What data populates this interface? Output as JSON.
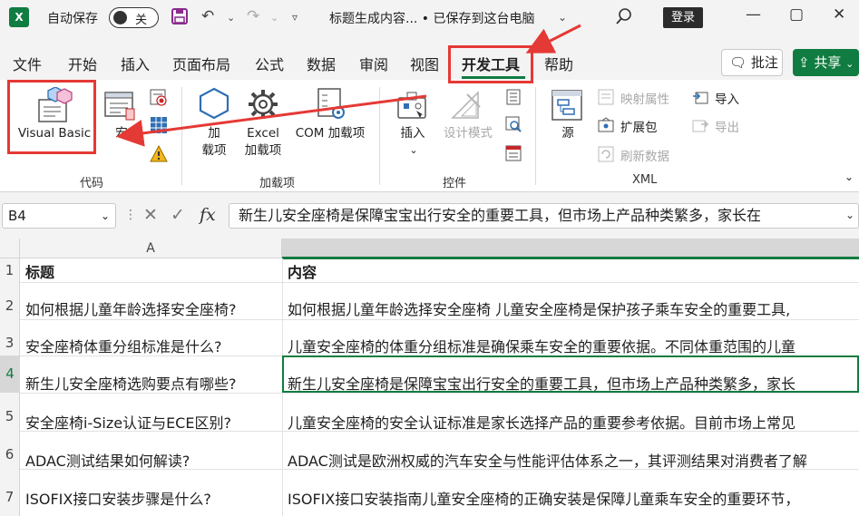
{
  "titlebar": {
    "app_icon": "X",
    "autosave_label": "自动保存",
    "autosave_state": "关",
    "doc_title": "标题生成内容... • 已保存到这台电脑",
    "login": "登录",
    "icons": [
      "save-icon",
      "undo-icon",
      "redo-icon",
      "customize-icon",
      "search-icon",
      "minimize-icon",
      "maximize-icon",
      "close-icon"
    ]
  },
  "tabs": [
    "文件",
    "开始",
    "插入",
    "页面布局",
    "公式",
    "数据",
    "审阅",
    "视图",
    "开发工具",
    "帮助"
  ],
  "active_tab": "开发工具",
  "comment_btn": "批注",
  "share_btn": "共享",
  "ribbon": {
    "code_group": {
      "label": "代码",
      "visual_basic": "Visual Basic",
      "macro": "宏"
    },
    "addins_group": {
      "label": "加载项",
      "addins": "加\n载项",
      "excel_addins": "Excel\n加载项",
      "com_addins": "COM 加载项"
    },
    "controls_group": {
      "label": "控件",
      "insert": "插入",
      "design_mode": "设计模式"
    },
    "xml_group": {
      "label": "XML",
      "source": "源",
      "map_properties": "映射属性",
      "expansion_pack": "扩展包",
      "refresh_data": "刷新数据",
      "import": "导入",
      "export": "导出"
    }
  },
  "formula_bar": {
    "cell_ref": "B4",
    "fx": "fx",
    "content": "新生儿安全座椅是保障宝宝出行安全的重要工具，但市场上产品种类繁多，家长在"
  },
  "grid": {
    "col_a": "A",
    "rows": [
      {
        "num": "1",
        "a": "标题",
        "b": "内容"
      },
      {
        "num": "2",
        "a": "如何根据儿童年龄选择安全座椅?",
        "b": "如何根据儿童年龄选择安全座椅  儿童安全座椅是保护孩子乘车安全的重要工具,"
      },
      {
        "num": "3",
        "a": "安全座椅体重分组标准是什么?",
        "b": "儿童安全座椅的体重分组标准是确保乘车安全的重要依据。不同体重范围的儿童"
      },
      {
        "num": "4",
        "a": "新生儿安全座椅选购要点有哪些?",
        "b": "新生儿安全座椅是保障宝宝出行安全的重要工具，但市场上产品种类繁多，家长"
      },
      {
        "num": "5",
        "a": "安全座椅i-Size认证与ECE区别?",
        "b": "儿童安全座椅的安全认证标准是家长选择产品的重要参考依据。目前市场上常见"
      },
      {
        "num": "6",
        "a": "ADAC测试结果如何解读?",
        "b": "ADAC测试是欧洲权威的汽车安全与性能评估体系之一，其评测结果对消费者了解"
      },
      {
        "num": "7",
        "a": "ISOFIX接口安装步骤是什么?",
        "b": "ISOFIX接口安装指南儿童安全座椅的正确安装是保障儿童乘车安全的重要环节，"
      }
    ]
  },
  "colors": {
    "accent": "#107c41",
    "annotation": "#e53935"
  }
}
